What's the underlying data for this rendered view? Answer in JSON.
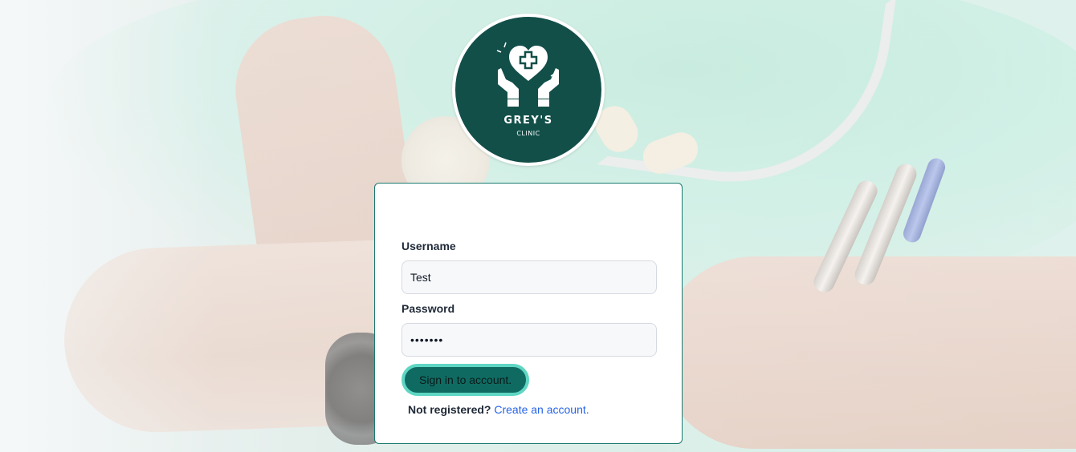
{
  "logo": {
    "brand": "GREY'S",
    "sub": "CLINIC",
    "icon": "heart-hands-medical-icon",
    "bg_color": "#124f49"
  },
  "form": {
    "username_label": "Username",
    "username_value": "Test",
    "password_label": "Password",
    "password_value": "•••••••",
    "submit_label": "Sign in to account.",
    "register_prompt": "Not registered?",
    "register_link": "Create an account."
  },
  "colors": {
    "accent": "#0f6b62",
    "accent_ring": "#5fd6c3",
    "link": "#2563eb",
    "card_border": "#1a7a70"
  }
}
